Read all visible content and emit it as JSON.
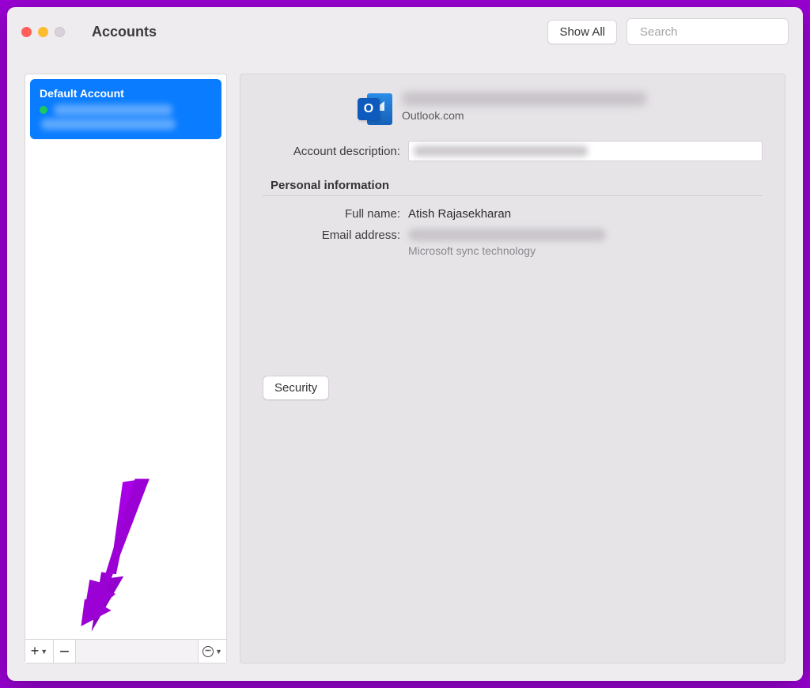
{
  "window": {
    "title": "Accounts",
    "show_all_label": "Show All",
    "search_placeholder": "Search"
  },
  "sidebar": {
    "accounts": [
      {
        "title": "Default Account",
        "status": "online",
        "line1_redacted": true,
        "line2_redacted": true
      }
    ],
    "footer": {
      "add_label": "+",
      "remove_label": "−",
      "more_label": "…"
    }
  },
  "detail": {
    "provider": "Outlook.com",
    "email_redacted": true,
    "labels": {
      "account_description": "Account description:",
      "personal_info_section": "Personal information",
      "full_name": "Full name:",
      "email_address": "Email address:"
    },
    "values": {
      "account_description_redacted": true,
      "full_name": "Atish Rajasekharan",
      "email_address_redacted": true,
      "sync_note": "Microsoft sync technology"
    },
    "security_button": "Security"
  },
  "colors": {
    "accent_blue": "#0a7cff",
    "outlook_blue": "#1560b8",
    "status_green": "#1ec860",
    "annotation_purple": "#9b00d4"
  }
}
